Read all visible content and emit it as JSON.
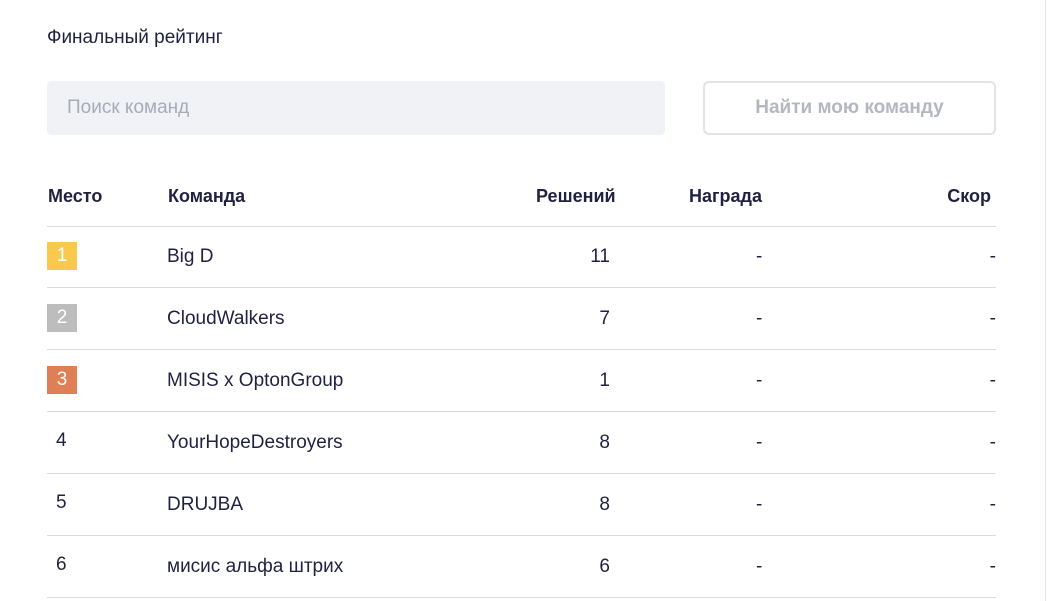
{
  "title": "Финальный рейтинг",
  "search": {
    "placeholder": "Поиск команд",
    "value": ""
  },
  "find_button": "Найти мою команду",
  "colors": {
    "gold": "#f9c94f",
    "silver": "#bdbdbd",
    "bronze": "#df7f55"
  },
  "columns": {
    "place": "Место",
    "team": "Команда",
    "solved": "Решений",
    "prize": "Награда",
    "score": "Скор"
  },
  "rows": [
    {
      "place": "1",
      "medal": "gold",
      "team": "Big D",
      "solved": "11",
      "prize": "-",
      "score": "-"
    },
    {
      "place": "2",
      "medal": "silver",
      "team": "CloudWalkers",
      "solved": "7",
      "prize": "-",
      "score": "-"
    },
    {
      "place": "3",
      "medal": "bronze",
      "team": "MISIS x OptonGroup",
      "solved": "1",
      "prize": "-",
      "score": "-"
    },
    {
      "place": "4",
      "medal": "",
      "team": "YourHopeDestroyers",
      "solved": "8",
      "prize": "-",
      "score": "-"
    },
    {
      "place": "5",
      "medal": "",
      "team": "DRUJBA",
      "solved": "8",
      "prize": "-",
      "score": "-"
    },
    {
      "place": "6",
      "medal": "",
      "team": "мисис альфа штрих",
      "solved": "6",
      "prize": "-",
      "score": "-"
    }
  ]
}
